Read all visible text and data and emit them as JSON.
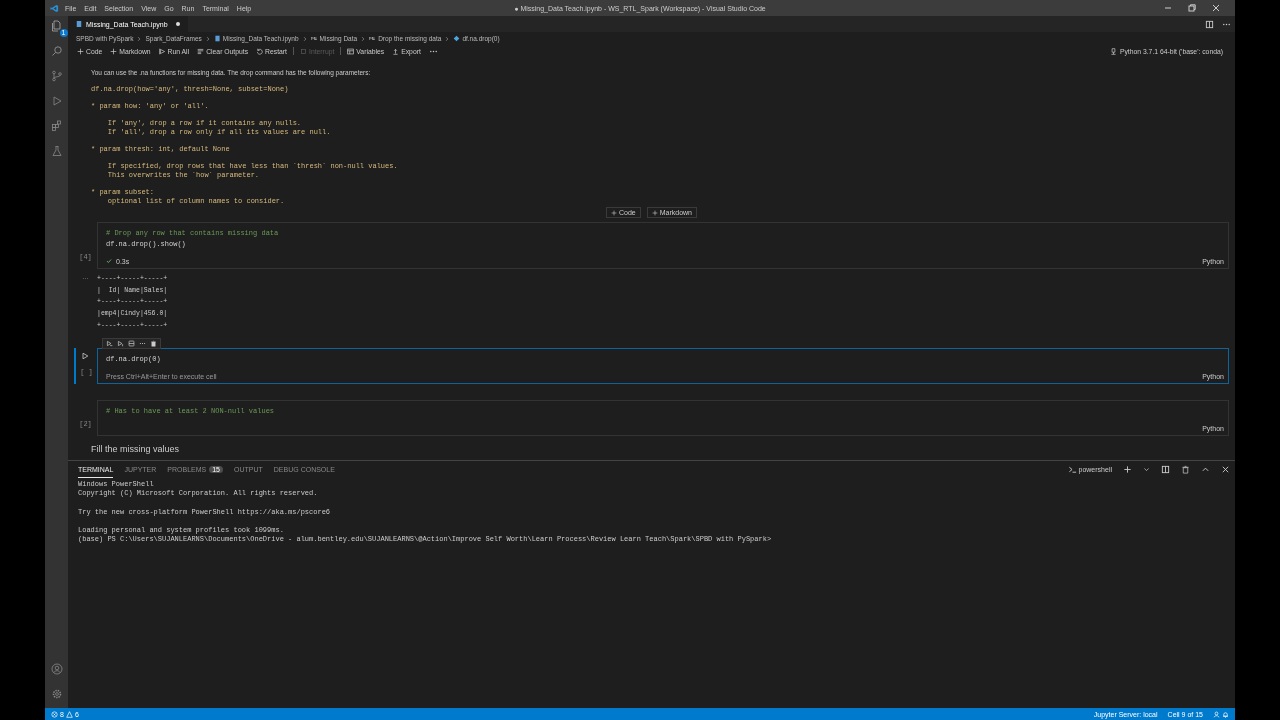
{
  "window": {
    "title": "● Missing_Data Teach.ipynb - WS_RTL_Spark (Workspace) - Visual Studio Code"
  },
  "menu": [
    "File",
    "Edit",
    "Selection",
    "View",
    "Go",
    "Run",
    "Terminal",
    "Help"
  ],
  "activity_bar": {
    "explorer_badge": "1"
  },
  "tab": {
    "label": "Missing_Data Teach.ipynb",
    "dirty": true
  },
  "breadcrumbs": [
    {
      "label": "SPBD with PySpark",
      "kind": "folder"
    },
    {
      "label": "Spark_DataFrames",
      "kind": "folder"
    },
    {
      "label": "Missing_Data Teach.ipynb",
      "kind": "file"
    },
    {
      "label": "Missing Data",
      "kind": "heading"
    },
    {
      "label": "Drop the missing data",
      "kind": "heading"
    },
    {
      "label": "df.na.drop(0)",
      "kind": "cell"
    }
  ],
  "toolbar": [
    {
      "label": "Code",
      "kind": "add",
      "disabled": false
    },
    {
      "label": "Markdown",
      "kind": "add",
      "disabled": false
    },
    {
      "label": "Run All",
      "kind": "run",
      "disabled": false
    },
    {
      "label": "Clear Outputs",
      "kind": "clear",
      "disabled": false
    },
    {
      "label": "Restart",
      "kind": "restart",
      "disabled": false
    },
    {
      "label": "Interrupt",
      "kind": "interrupt",
      "disabled": true
    },
    {
      "label": "Variables",
      "kind": "variables",
      "disabled": false
    },
    {
      "label": "Export",
      "kind": "export",
      "disabled": false
    }
  ],
  "kernel": "Python 3.7.1 64-bit ('base': conda)",
  "markdown": {
    "intro": "You can use the .na functions for missing data. The drop command has the following parameters:",
    "code_blocks": [
      [
        "df.na.drop(how='any', thresh=None, subset=None)"
      ],
      [
        "* param how: 'any' or 'all'."
      ],
      [
        "    If 'any', drop a row if it contains any nulls.",
        "    If 'all', drop a row only if all its values are null."
      ],
      [
        "* param thresh: int, default None"
      ],
      [
        "    If specified, drop rows that have less than `thresh` non-null values.",
        "    This overwrites the `how` parameter."
      ],
      [
        "* param subset:",
        "    optional list of column names to consider."
      ]
    ]
  },
  "add_cell_buttons": [
    "Code",
    "Markdown"
  ],
  "cells": [
    {
      "execution_count": "[4]",
      "selected": false,
      "language": "Python",
      "status": "0.3s",
      "code": [
        {
          "kind": "comment",
          "text": "# Drop any row that contains missing data"
        },
        {
          "kind": "code",
          "text": "df.na.drop().show()"
        }
      ],
      "output_label": "...",
      "output": [
        "+----+-----+-----+",
        "|  Id| Name|Sales|",
        "+----+-----+-----+",
        "|emp4|Cindy|456.0|",
        "+----+-----+-----+"
      ]
    },
    {
      "execution_count": "[ ]",
      "selected": true,
      "language": "Python",
      "hint": "Press Ctrl+Alt+Enter to execute cell",
      "code": [
        {
          "kind": "code",
          "text": "df.na.drop(0)"
        }
      ]
    },
    {
      "execution_count": "[2]",
      "selected": false,
      "language": "Python",
      "code": [
        {
          "kind": "comment",
          "text": "# Has to have at least 2 NON-null values"
        }
      ]
    }
  ],
  "next_heading": "Fill the missing values",
  "panel": {
    "tabs": [
      {
        "label": "TERMINAL",
        "selected": true
      },
      {
        "label": "JUPYTER",
        "selected": false
      },
      {
        "label": "PROBLEMS",
        "selected": false,
        "badge": "15"
      },
      {
        "label": "OUTPUT",
        "selected": false
      },
      {
        "label": "DEBUG CONSOLE",
        "selected": false
      }
    ],
    "terminal_name": "powershell",
    "blocks": [
      [
        "Windows PowerShell",
        "Copyright (C) Microsoft Corporation. All rights reserved."
      ],
      [
        "Try the new cross-platform PowerShell https://aka.ms/pscore6"
      ],
      [
        "Loading personal and system profiles took 1099ms.",
        "(base) PS C:\\Users\\SUJANLEARNS\\Documents\\OneDrive - alum.bentley.edu\\SUJANLEARNS\\@Action\\Improve Self Worth\\Learn Process\\Review Learn Teach\\Spark\\SPBD with PySpark>"
      ]
    ]
  },
  "status_bar": {
    "errors": "8",
    "warnings": "6",
    "items": [
      "Jupyter Server: local",
      "Cell 9 of 15"
    ]
  }
}
